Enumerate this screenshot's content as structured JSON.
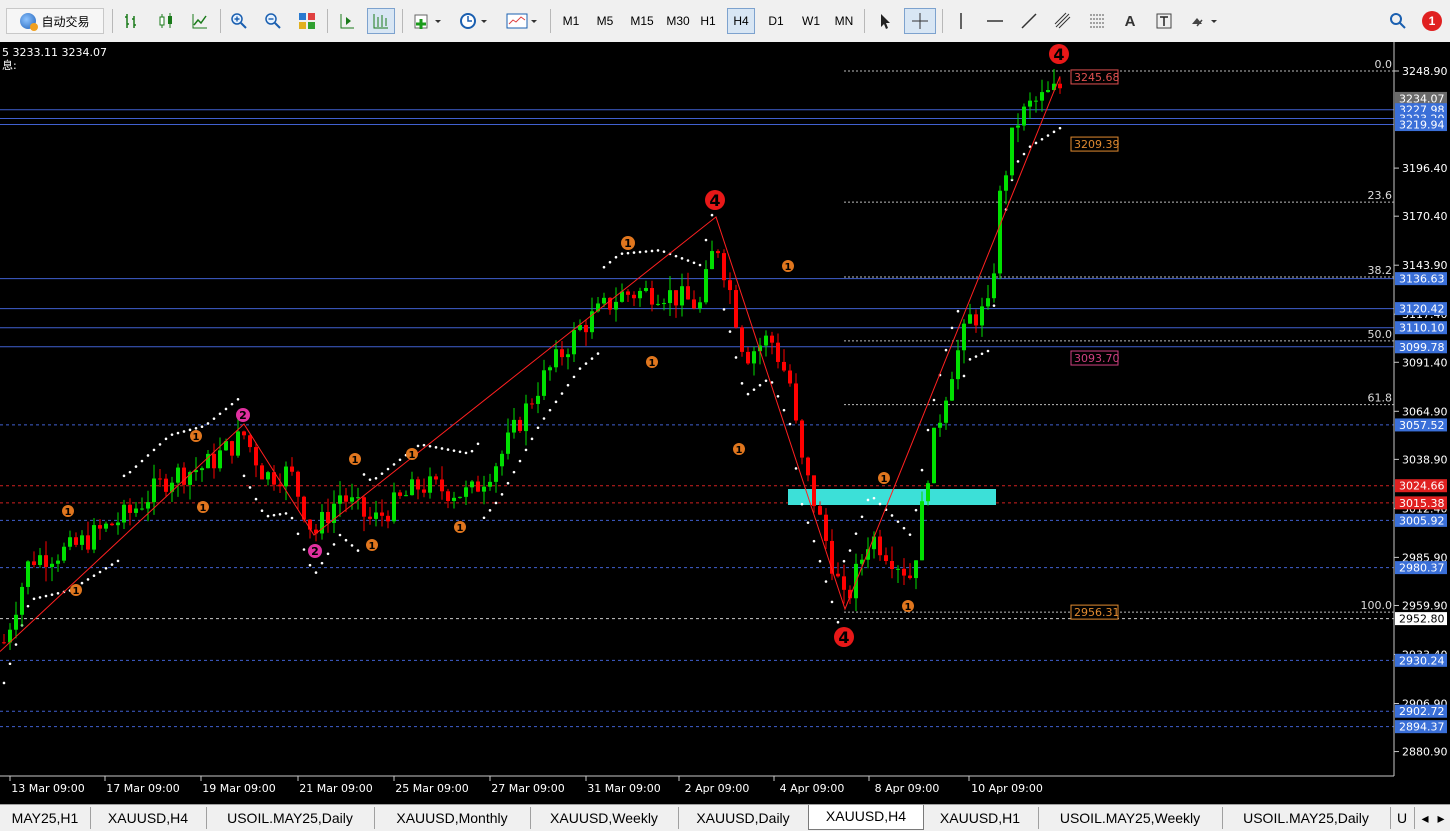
{
  "toolbar": {
    "auto_trading_label": "自动交易",
    "timeframes": [
      "M1",
      "M5",
      "M15",
      "M30",
      "H1",
      "H4",
      "D1",
      "W1",
      "MN"
    ],
    "active_timeframe": "H4",
    "notification_count": "1"
  },
  "chart": {
    "info_line1": "5 3233.11 3234.07",
    "info_line2": "息:",
    "price_axis_ticks": [
      "3248.90",
      "3196.40",
      "3170.40",
      "3143.90",
      "3117.40",
      "3091.40",
      "3064.90",
      "3038.90",
      "3012.40",
      "2985.90",
      "2959.90",
      "2933.40",
      "2906.90",
      "2880.90"
    ],
    "price_boxes": [
      {
        "label": "3234.07",
        "color": "#6a6a6a"
      },
      {
        "label": "3227.98",
        "color": "#3a6fd8"
      },
      {
        "label": "3223.20",
        "color": "#3a6fd8"
      },
      {
        "label": "3219.94",
        "color": "#3a6fd8"
      },
      {
        "label": "3136.63",
        "color": "#3a6fd8"
      },
      {
        "label": "3120.42",
        "color": "#3a6fd8"
      },
      {
        "label": "3110.10",
        "color": "#3a6fd8"
      },
      {
        "label": "3099.78",
        "color": "#3a6fd8"
      },
      {
        "label": "3057.52",
        "color": "#3a6fd8"
      },
      {
        "label": "3024.66",
        "color": "#e02020"
      },
      {
        "label": "3015.38",
        "color": "#e02020"
      },
      {
        "label": "3005.92",
        "color": "#3a6fd8"
      },
      {
        "label": "2980.37",
        "color": "#3a6fd8"
      },
      {
        "label": "2952.80",
        "color": "#ffffff"
      },
      {
        "label": "2930.24",
        "color": "#3a6fd8"
      },
      {
        "label": "2902.72",
        "color": "#3a6fd8"
      },
      {
        "label": "2894.37",
        "color": "#3a6fd8"
      }
    ],
    "fib_levels": [
      {
        "label": "0.0",
        "price": 3248.9
      },
      {
        "label": "23.6",
        "price": 3178.0
      },
      {
        "label": "38.2",
        "price": 3137.5
      },
      {
        "label": "50.0",
        "price": 3103.0
      },
      {
        "label": "61.8",
        "price": 3068.5
      },
      {
        "label": "100.0",
        "price": 2956.3
      }
    ],
    "price_labels_on_chart": [
      {
        "label": "3245.68",
        "color": "#e05050"
      },
      {
        "label": "3209.39",
        "color": "#e08a30"
      },
      {
        "label": "3093.70",
        "color": "#d04080"
      },
      {
        "label": "2956.31",
        "color": "#e08a30"
      }
    ],
    "time_labels": [
      "13 Mar 09:00",
      "17 Mar 09:00",
      "19 Mar 09:00",
      "21 Mar 09:00",
      "25 Mar 09:00",
      "27 Mar 09:00",
      "31 Mar 09:00",
      "2 Apr 09:00",
      "4 Apr 09:00",
      "8 Apr 09:00",
      "10 Apr 09:00"
    ],
    "wave_markers": [
      {
        "label": "4",
        "color": "#e81818",
        "kind": "large"
      },
      {
        "label": "4",
        "color": "#e81818",
        "kind": "large"
      },
      {
        "label": "4",
        "color": "#e81818",
        "kind": "large"
      },
      {
        "label": "2",
        "color": "#e030a0",
        "kind": "small"
      },
      {
        "label": "2",
        "color": "#e030a0",
        "kind": "small"
      },
      {
        "label": "1",
        "color": "#e0761e",
        "kind": "small"
      }
    ],
    "colors": {
      "bull": "#00e000",
      "bear": "#ff0000",
      "background": "#000000",
      "zigzag": "#ff2020",
      "zone": "#3ce0d8"
    }
  },
  "tabs": [
    "MAY25,H1",
    "XAUUSD,H4",
    "USOIL.MAY25,Daily",
    "XAUUSD,Monthly",
    "XAUUSD,Weekly",
    "XAUUSD,Daily",
    "XAUUSD,H4",
    "XAUUSD,H1",
    "USOIL.MAY25,Weekly",
    "USOIL.MAY25,Daily",
    "U"
  ],
  "active_tab": "XAUUSD,H4"
}
